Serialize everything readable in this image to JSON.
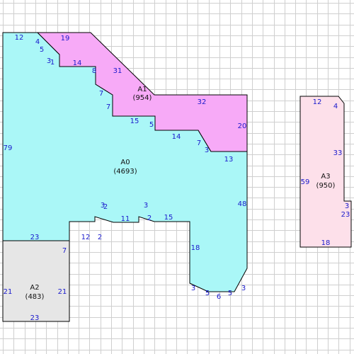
{
  "colors": {
    "grid": "#cfcfcf",
    "outline": "#000000",
    "dimension_text": "#1a1acc",
    "area_text": "#111111"
  },
  "regions": [
    {
      "id": "A0",
      "name": "A0",
      "area": "(4693)",
      "fill": "#aaf7f7",
      "edges": [
        "12",
        "4",
        "5",
        "3",
        "1",
        "14",
        "8",
        "7",
        "7",
        "15",
        "5",
        "14",
        "7",
        "3",
        "13",
        "48",
        "3",
        "5",
        "6",
        "5",
        "3",
        "18",
        "15",
        "2",
        "3",
        "11",
        "3",
        "2",
        "12",
        "2",
        "7",
        "23",
        "79"
      ]
    },
    {
      "id": "A1",
      "name": "A1",
      "area": "(954)",
      "fill": "#f7aaf7",
      "edges": [
        "19",
        "31",
        "32",
        "20"
      ]
    },
    {
      "id": "A2",
      "name": "A2",
      "area": "(483)",
      "fill": "#e6e6e6",
      "edges": [
        "21",
        "21",
        "23",
        "23"
      ]
    },
    {
      "id": "A3",
      "name": "A3",
      "area": "(950)",
      "fill": "#fde0ea",
      "edges": [
        "12",
        "4",
        "33",
        "3",
        "23",
        "18",
        "59"
      ]
    }
  ]
}
